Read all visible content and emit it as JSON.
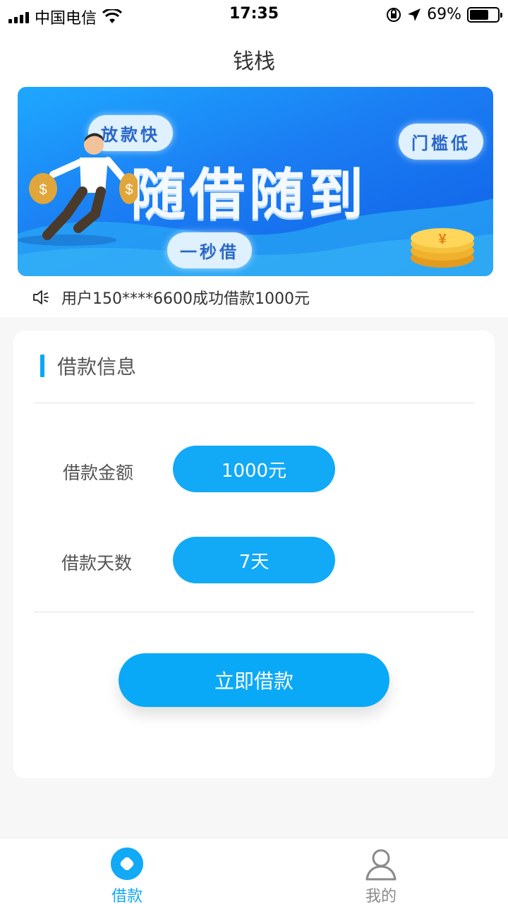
{
  "status_bar": {
    "carrier": "中国电信",
    "time": "17:35",
    "battery": "69%",
    "battery_level": 0.69
  },
  "header": {
    "title": "钱栈"
  },
  "banner": {
    "headline": "随借随到",
    "tag_fast": "放款快",
    "tag_low": "门槛低",
    "tag_second": "一秒借"
  },
  "notice": {
    "text": "用户150****6600成功借款1000元"
  },
  "loan": {
    "section_title": "借款信息",
    "amount_label": "借款金额",
    "amount_value": "1000元",
    "days_label": "借款天数",
    "days_value": "7天",
    "submit_label": "立即借款"
  },
  "tabbar": {
    "items": [
      {
        "label": "借款",
        "icon": "loan-icon",
        "active": true
      },
      {
        "label": "我的",
        "icon": "user-icon",
        "active": false
      }
    ]
  },
  "colors": {
    "accent": "#12a9f7",
    "inactive": "#8a8a8a"
  }
}
